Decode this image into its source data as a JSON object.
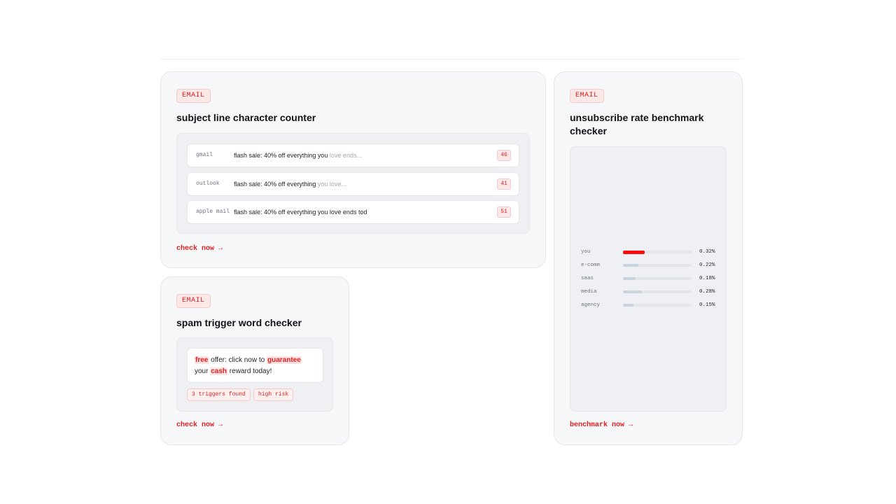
{
  "cards": {
    "subject": {
      "badge": "EMAIL",
      "title": "subject line character counter",
      "rows": [
        {
          "client": "gmail",
          "text": "flash sale: 40% off everything you ",
          "fade": "love ends...",
          "count": "46"
        },
        {
          "client": "outlook",
          "text": "flash sale: 40% off everything ",
          "fade": "you love...",
          "count": "41"
        },
        {
          "client": "apple mail",
          "text": "flash sale: 40% off everything you love ends tod",
          "fade": "",
          "count": "51"
        }
      ],
      "cta": "check now →"
    },
    "spam": {
      "badge": "EMAIL",
      "title": "spam trigger word checker",
      "text": {
        "w1": "free",
        "t1": " offer: click now to ",
        "w2": "guarantee",
        "t2": " your ",
        "w3": "cash",
        "t3": " reward today!"
      },
      "pills": [
        "3 triggers found",
        "high risk"
      ],
      "cta": "check now →"
    },
    "unsub": {
      "badge": "EMAIL",
      "title_line1": "unsubscribe rate benchmark",
      "title_line2": "checker",
      "benchmarks": [
        {
          "label": "you",
          "value": "0.32%",
          "rate": 0.32
        },
        {
          "label": "e-comm",
          "value": "0.22%",
          "rate": 0.22
        },
        {
          "label": "saas",
          "value": "0.18%",
          "rate": 0.18
        },
        {
          "label": "media",
          "value": "0.28%",
          "rate": 0.28
        },
        {
          "label": "agency",
          "value": "0.15%",
          "rate": 0.15
        }
      ],
      "cta": "benchmark now →"
    }
  },
  "colors": {
    "accent": "#e11d1d",
    "you_bar": "#ff0a0a",
    "bench_bar": "#c9d3de"
  }
}
